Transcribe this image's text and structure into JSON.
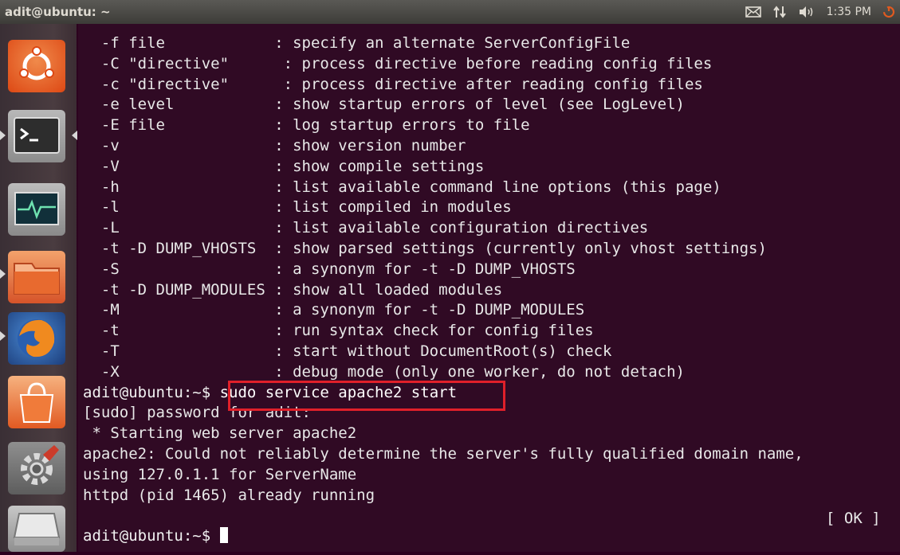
{
  "window": {
    "title": "adit@ubuntu: ~"
  },
  "panel": {
    "indicators": [
      {
        "icon": "mail-icon"
      },
      {
        "icon": "network-updown-icon"
      },
      {
        "icon": "volume-icon"
      }
    ],
    "clock": "1:35 PM"
  },
  "launcher": {
    "items": [
      {
        "icon": "ubuntu-dash-icon"
      },
      {
        "icon": "terminal-icon"
      },
      {
        "icon": "system-monitor-icon"
      },
      {
        "icon": "files-folder-icon"
      },
      {
        "icon": "firefox-icon"
      },
      {
        "icon": "software-center-icon"
      },
      {
        "icon": "system-settings-icon"
      },
      {
        "icon": "file-manager-icon"
      }
    ]
  },
  "terminal": {
    "lines": [
      "  -f file            : specify an alternate ServerConfigFile",
      "  -C \"directive\"      : process directive before reading config files",
      "  -c \"directive\"      : process directive after reading config files",
      "  -e level           : show startup errors of level (see LogLevel)",
      "  -E file            : log startup errors to file",
      "  -v                 : show version number",
      "  -V                 : show compile settings",
      "  -h                 : list available command line options (this page)",
      "  -l                 : list compiled in modules",
      "  -L                 : list available configuration directives",
      "  -t -D DUMP_VHOSTS  : show parsed settings (currently only vhost settings)",
      "  -S                 : a synonym for -t -D DUMP_VHOSTS",
      "  -t -D DUMP_MODULES : show all loaded modules",
      "  -M                 : a synonym for -t -D DUMP_MODULES",
      "  -t                 : run syntax check for config files",
      "  -T                 : start without DocumentRoot(s) check",
      "  -X                 : debug mode (only one worker, do not detach)"
    ],
    "prompt1": "adit@ubuntu:~$ ",
    "command": "sudo service apache2 start",
    "output": [
      "[sudo] password for adit:",
      " * Starting web server apache2",
      "apache2: Could not reliably determine the server's fully qualified domain name,",
      "using 127.0.1.1 for ServerName",
      "httpd (pid 1465) already running"
    ],
    "ok_status": "[ OK ]",
    "prompt2": "adit@ubuntu:~$ "
  },
  "colors": {
    "terminal_bg": "#300a24",
    "highlight": "#e0202a",
    "panel_bg": "#3d3c38",
    "launcher_bg": "#4a3c40"
  }
}
